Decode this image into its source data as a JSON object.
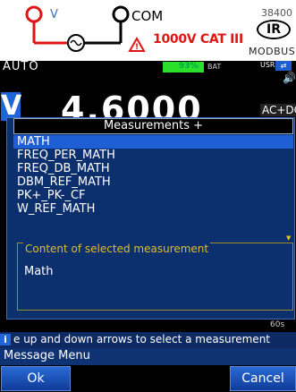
{
  "header": {
    "com_label": "COM",
    "warning_text": "1000V CAT III",
    "serial_text": "38400",
    "ir_label": "IR",
    "modbus_label": "MODBUS"
  },
  "status": {
    "mode": "AUTO",
    "battery_text": "93%",
    "battery_label": "BAT",
    "usr_label": "USR"
  },
  "reading": {
    "unit_badge": "V",
    "value": "4.6000",
    "coupling": "AC+DC"
  },
  "dialog": {
    "title": "Measurements +",
    "items": [
      "MATH",
      "FREQ_PER_MATH",
      "FREQ_DB_MATH",
      "DBM_REF_MATH",
      "PK+_PK-_CF",
      "W_REF_MATH"
    ],
    "selected_index": 0,
    "content_label": "Content of selected measurement",
    "content_value": "Math"
  },
  "bottom": {
    "small_right": "60s"
  },
  "hint": {
    "text": "e up and down arrows to select a measurement"
  },
  "menu": {
    "title": "Message Menu"
  },
  "softkeys": {
    "ok": "Ok",
    "cancel": "Cancel"
  },
  "colors": {
    "selection": "#1f5fd6",
    "dialog_bg": "#0c2f6e",
    "content_label": "#e0bd2a",
    "warning": "#e01515"
  }
}
